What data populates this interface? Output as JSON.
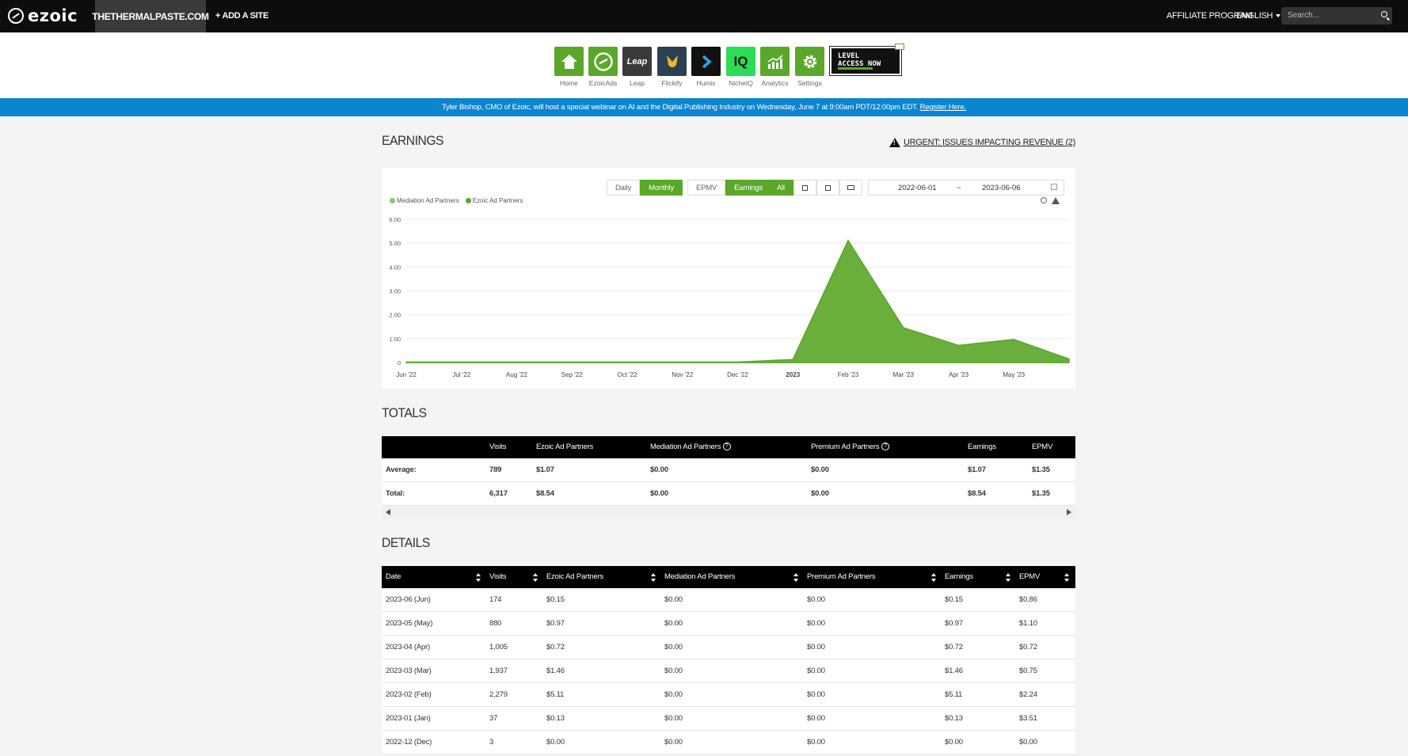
{
  "topbar": {
    "brand": "ezoic",
    "site": "THETHERMALPASTE.COM",
    "add_site": "+ ADD A SITE",
    "affiliate": "AFFILIATE PROGRAM",
    "language": "ENGLISH",
    "search_placeholder": "Search..."
  },
  "apps": [
    {
      "label": "Home",
      "icon": "home-icon",
      "color": "#5aa82a"
    },
    {
      "label": "EzoicAds",
      "icon": "ezoic-logo-icon",
      "color": "#5aa82a"
    },
    {
      "label": "Leap",
      "icon": "leap-icon",
      "color": "#3a3a3a"
    },
    {
      "label": "Flickify",
      "icon": "flickify-icon",
      "color": "#2d4052"
    },
    {
      "label": "Humix",
      "icon": "humix-icon",
      "color": "#111111"
    },
    {
      "label": "NicheIQ",
      "icon": "iq-icon",
      "color": "#2bdc57"
    },
    {
      "label": "Analytics",
      "icon": "analytics-icon",
      "color": "#5aa82a"
    },
    {
      "label": "Settings",
      "icon": "gear-icon",
      "color": "#5aa82a"
    }
  ],
  "leap_text": "Leap",
  "iq_text": "IQ",
  "level_access": {
    "line1": "LEVEL",
    "line2": "ACCESS NOW"
  },
  "banner": {
    "text": "Tyler Bishop, CMO of Ezoic, will host a special webinar on AI and the Digital Publishing Industry on Wednesday, June 7 at 9:00am PDT/12:00pm EDT.",
    "link": "Register Here."
  },
  "earnings": {
    "title": "EARNINGS",
    "urgent": "URGENT: ISSUES IMPACTING REVENUE (2)",
    "buttons": {
      "daily": "Daily",
      "monthly": "Monthly",
      "epmv": "EPMV",
      "earnings": "Earnings",
      "all": "All"
    },
    "date_from": "2022-06-01",
    "date_sep": "~",
    "date_to": "2023-06-06"
  },
  "chart_data": {
    "type": "area",
    "legend": [
      {
        "name": "Mediation Ad Partners",
        "color": "#8ac865"
      },
      {
        "name": "Ezoic Ad Partners",
        "color": "#5aa82a"
      }
    ],
    "y_ticks": [
      "0",
      "1.00",
      "2.00",
      "3.00",
      "4.00",
      "5.00",
      "6.00"
    ],
    "ylim": [
      0,
      6
    ],
    "x_ticks": [
      "Jun '22",
      "Jul '22",
      "Aug '22",
      "Sep '22",
      "Oct '22",
      "Nov '22",
      "Dec '22",
      "2023",
      "Feb '23",
      "Mar '23",
      "Apr '23",
      "May '23"
    ],
    "series": [
      {
        "name": "Mediation Ad Partners",
        "values": [
          0,
          0,
          0,
          0,
          0,
          0,
          0,
          0,
          0,
          0,
          0,
          0,
          0
        ]
      },
      {
        "name": "Ezoic Ad Partners",
        "values": [
          0.02,
          0.02,
          0.02,
          0.02,
          0.02,
          0.02,
          0.02,
          0.13,
          5.11,
          1.46,
          0.72,
          0.97,
          0.15
        ]
      }
    ],
    "grid": true
  },
  "totals": {
    "title": "TOTALS",
    "headers": [
      "",
      "Visits",
      "Ezoic Ad Partners",
      "Mediation Ad Partners",
      "Premium Ad Partners",
      "Earnings",
      "EPMV"
    ],
    "rows": [
      [
        "Average:",
        "789",
        "$1.07",
        "$0.00",
        "$0.00",
        "$1.07",
        "$1.35"
      ],
      [
        "Total:",
        "6,317",
        "$8.54",
        "$0.00",
        "$0.00",
        "$8.54",
        "$1.35"
      ]
    ],
    "help_glyph": "?"
  },
  "details": {
    "title": "DETAILS",
    "headers": [
      "Date",
      "Visits",
      "Ezoic Ad Partners",
      "Mediation Ad Partners",
      "Premium Ad Partners",
      "Earnings",
      "EPMV"
    ],
    "rows": [
      [
        "2023-06 (Jun)",
        "174",
        "$0.15",
        "$0.00",
        "$0.00",
        "$0.15",
        "$0.86"
      ],
      [
        "2023-05 (May)",
        "880",
        "$0.97",
        "$0.00",
        "$0.00",
        "$0.97",
        "$1.10"
      ],
      [
        "2023-04 (Apr)",
        "1,005",
        "$0.72",
        "$0.00",
        "$0.00",
        "$0.72",
        "$0.72"
      ],
      [
        "2023-03 (Mar)",
        "1,937",
        "$1.46",
        "$0.00",
        "$0.00",
        "$1.46",
        "$0.75"
      ],
      [
        "2023-02 (Feb)",
        "2,279",
        "$5.11",
        "$0.00",
        "$0.00",
        "$5.11",
        "$2.24"
      ],
      [
        "2023-01 (Jan)",
        "37",
        "$0.13",
        "$0.00",
        "$0.00",
        "$0.13",
        "$3.51"
      ],
      [
        "2022-12 (Dec)",
        "3",
        "$0.00",
        "$0.00",
        "$0.00",
        "$0.00",
        "$0.00"
      ]
    ]
  }
}
